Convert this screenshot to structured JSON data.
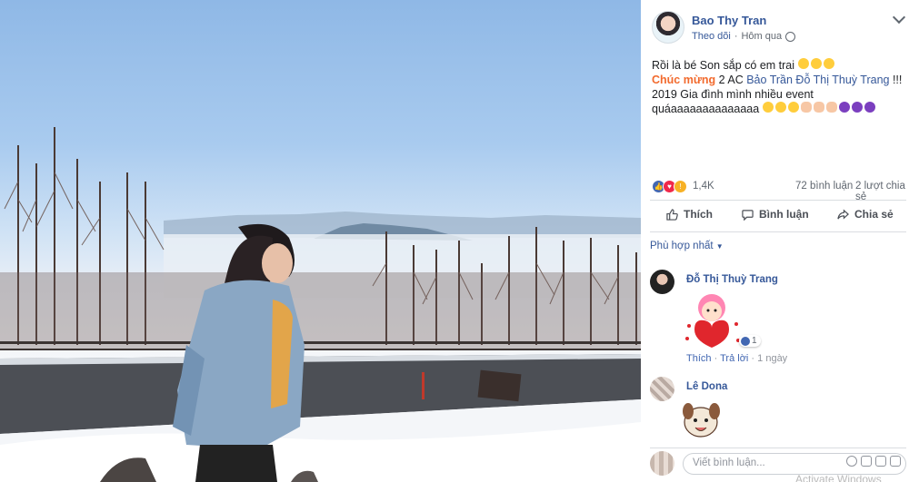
{
  "post": {
    "author": "Bao Thy Tran",
    "follow": "Theo dõi",
    "time": "Hôm qua",
    "line1": "Rồi là bé Son sắp có em trai",
    "congrats": "Chúc mừng",
    "mid": " 2 AC ",
    "tag": "Bảo Trần Đỗ Thị Thuỳ Trang",
    "excl": " !!!",
    "line3": "2019 Gia đình mình nhiều event",
    "line4": "quáaaaaaaaaaaaaaa"
  },
  "stats": {
    "reactions": "1,4K",
    "comments": "72 bình luận",
    "shares": "2 lượt chia sẻ"
  },
  "actions": {
    "like": "Thích",
    "comment": "Bình luận",
    "share": "Chia sẻ"
  },
  "sort_label": "Phù hợp nhất",
  "comments": [
    {
      "name": "Đỗ Thị Thuỳ Trang",
      "like": "Thích",
      "reply": "Trả lời",
      "time": "1 ngày",
      "reactions": "1"
    },
    {
      "name": "Lê Dona"
    }
  ],
  "composer": {
    "placeholder": "Viết bình luận..."
  },
  "watermark": "Activate Windows",
  "icons": [
    "chevron-down-icon",
    "globe-icon",
    "like-icon",
    "love-icon",
    "wow-icon",
    "comment-icon",
    "share-icon",
    "emoji-icon",
    "camera-icon",
    "gif-icon",
    "sticker-icon"
  ]
}
